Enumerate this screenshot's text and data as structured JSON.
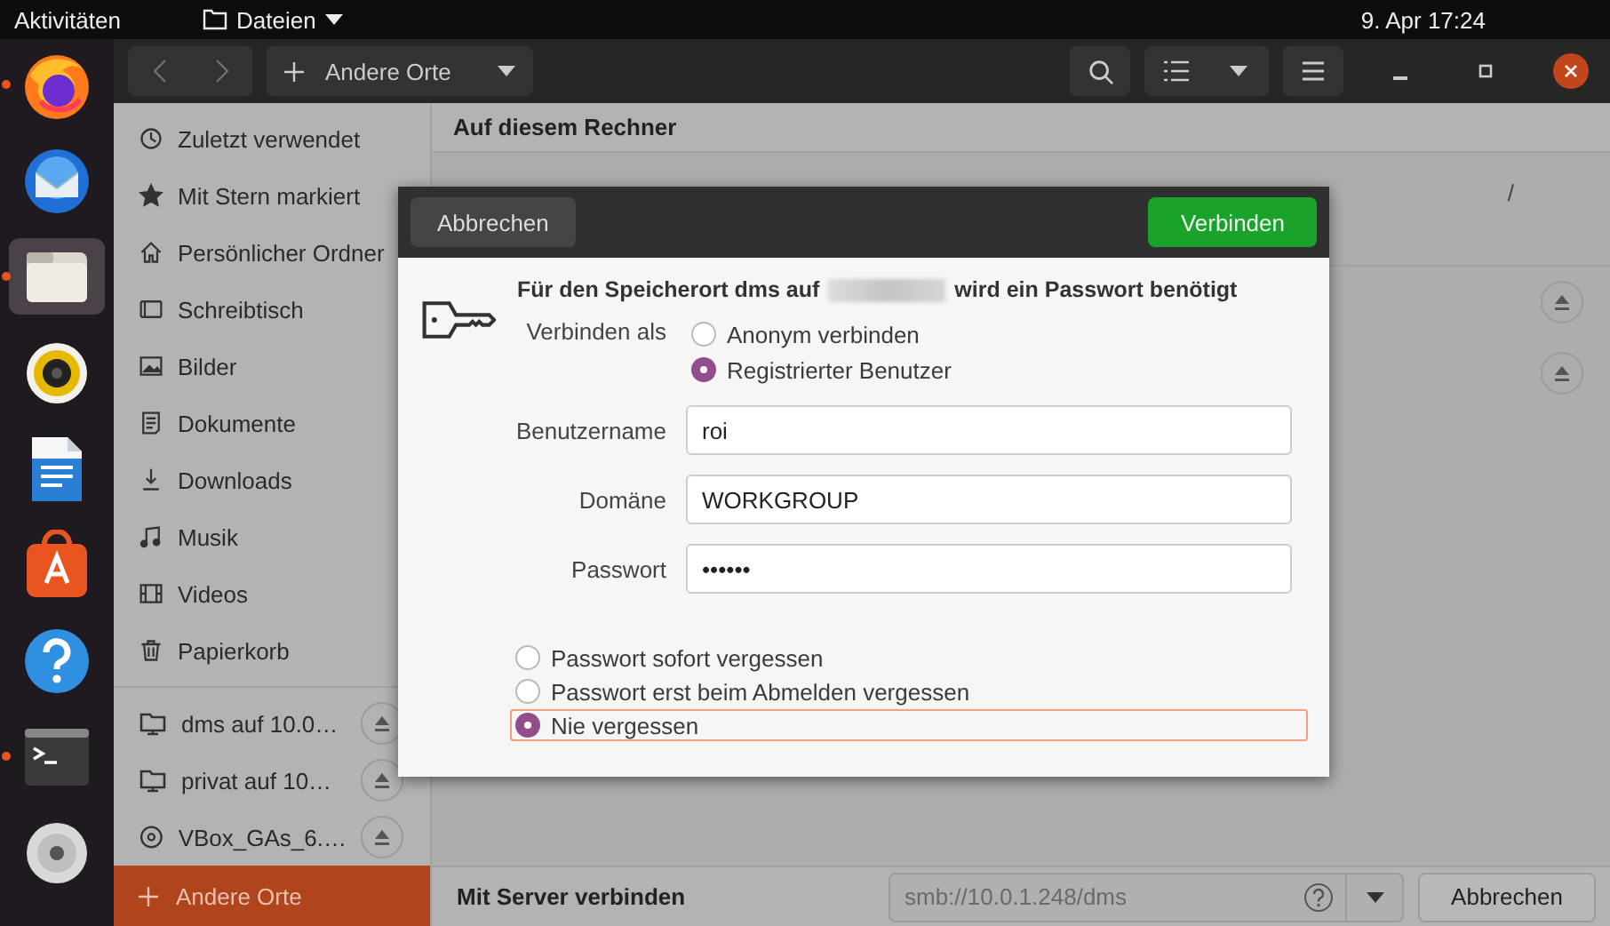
{
  "topbar": {
    "activities": "Aktivitäten",
    "app_menu": "Dateien",
    "clock": "9. Apr  17:24"
  },
  "dock": [
    {
      "kind": "firefox",
      "running": true,
      "selected": false
    },
    {
      "kind": "mail",
      "running": false,
      "selected": false
    },
    {
      "kind": "files",
      "running": true,
      "selected": true
    },
    {
      "kind": "music",
      "running": false,
      "selected": false
    },
    {
      "kind": "writer",
      "running": false,
      "selected": false
    },
    {
      "kind": "store",
      "running": false,
      "selected": false
    },
    {
      "kind": "help",
      "running": false,
      "selected": false
    },
    {
      "kind": "terminal",
      "running": true,
      "selected": false
    },
    {
      "kind": "disc",
      "running": false,
      "selected": false
    }
  ],
  "header": {
    "location": "Andere Orte"
  },
  "sidebar": {
    "items": [
      {
        "label": "Zuletzt verwendet"
      },
      {
        "label": "Mit Stern markiert"
      },
      {
        "label": "Persönlicher Ordner"
      },
      {
        "label": "Schreibtisch"
      },
      {
        "label": "Bilder"
      },
      {
        "label": "Dokumente"
      },
      {
        "label": "Downloads"
      },
      {
        "label": "Musik"
      },
      {
        "label": "Videos"
      },
      {
        "label": "Papierkorb"
      }
    ],
    "mounts": [
      {
        "kind": "share",
        "label": "dms auf 10.0…"
      },
      {
        "kind": "share",
        "label": "privat auf 10…"
      },
      {
        "kind": "disc",
        "label": "VBox_GAs_6.…"
      }
    ],
    "other": {
      "label": "Andere Orte",
      "selected": true
    }
  },
  "content": {
    "section_title": "Auf diesem Rechner",
    "path": "/"
  },
  "dialog": {
    "cancel": "Abbrechen",
    "connect": "Verbinden",
    "message_start": "Für den Speicherort dms auf",
    "message_end": "wird ein Passwort benötigt",
    "connect_as_label": "Verbinden als",
    "connect_as": [
      {
        "label": "Anonym verbinden",
        "selected": false
      },
      {
        "label": "Registrierter Benutzer",
        "selected": true
      }
    ],
    "fields": [
      {
        "label": "Benutzername",
        "value": "roi"
      },
      {
        "label": "Domäne",
        "value": "WORKGROUP"
      },
      {
        "label": "Passwort",
        "value": "••••••"
      }
    ],
    "remember": [
      {
        "label": "Passwort sofort vergessen",
        "selected": false
      },
      {
        "label": "Passwort erst beim Abmelden vergessen",
        "selected": false
      },
      {
        "label": "Nie vergessen",
        "selected": true
      }
    ]
  },
  "server_bar": {
    "label": "Mit Server verbinden",
    "placeholder": "smb://10.0.1.248/dms",
    "cancel": "Abbrechen"
  }
}
